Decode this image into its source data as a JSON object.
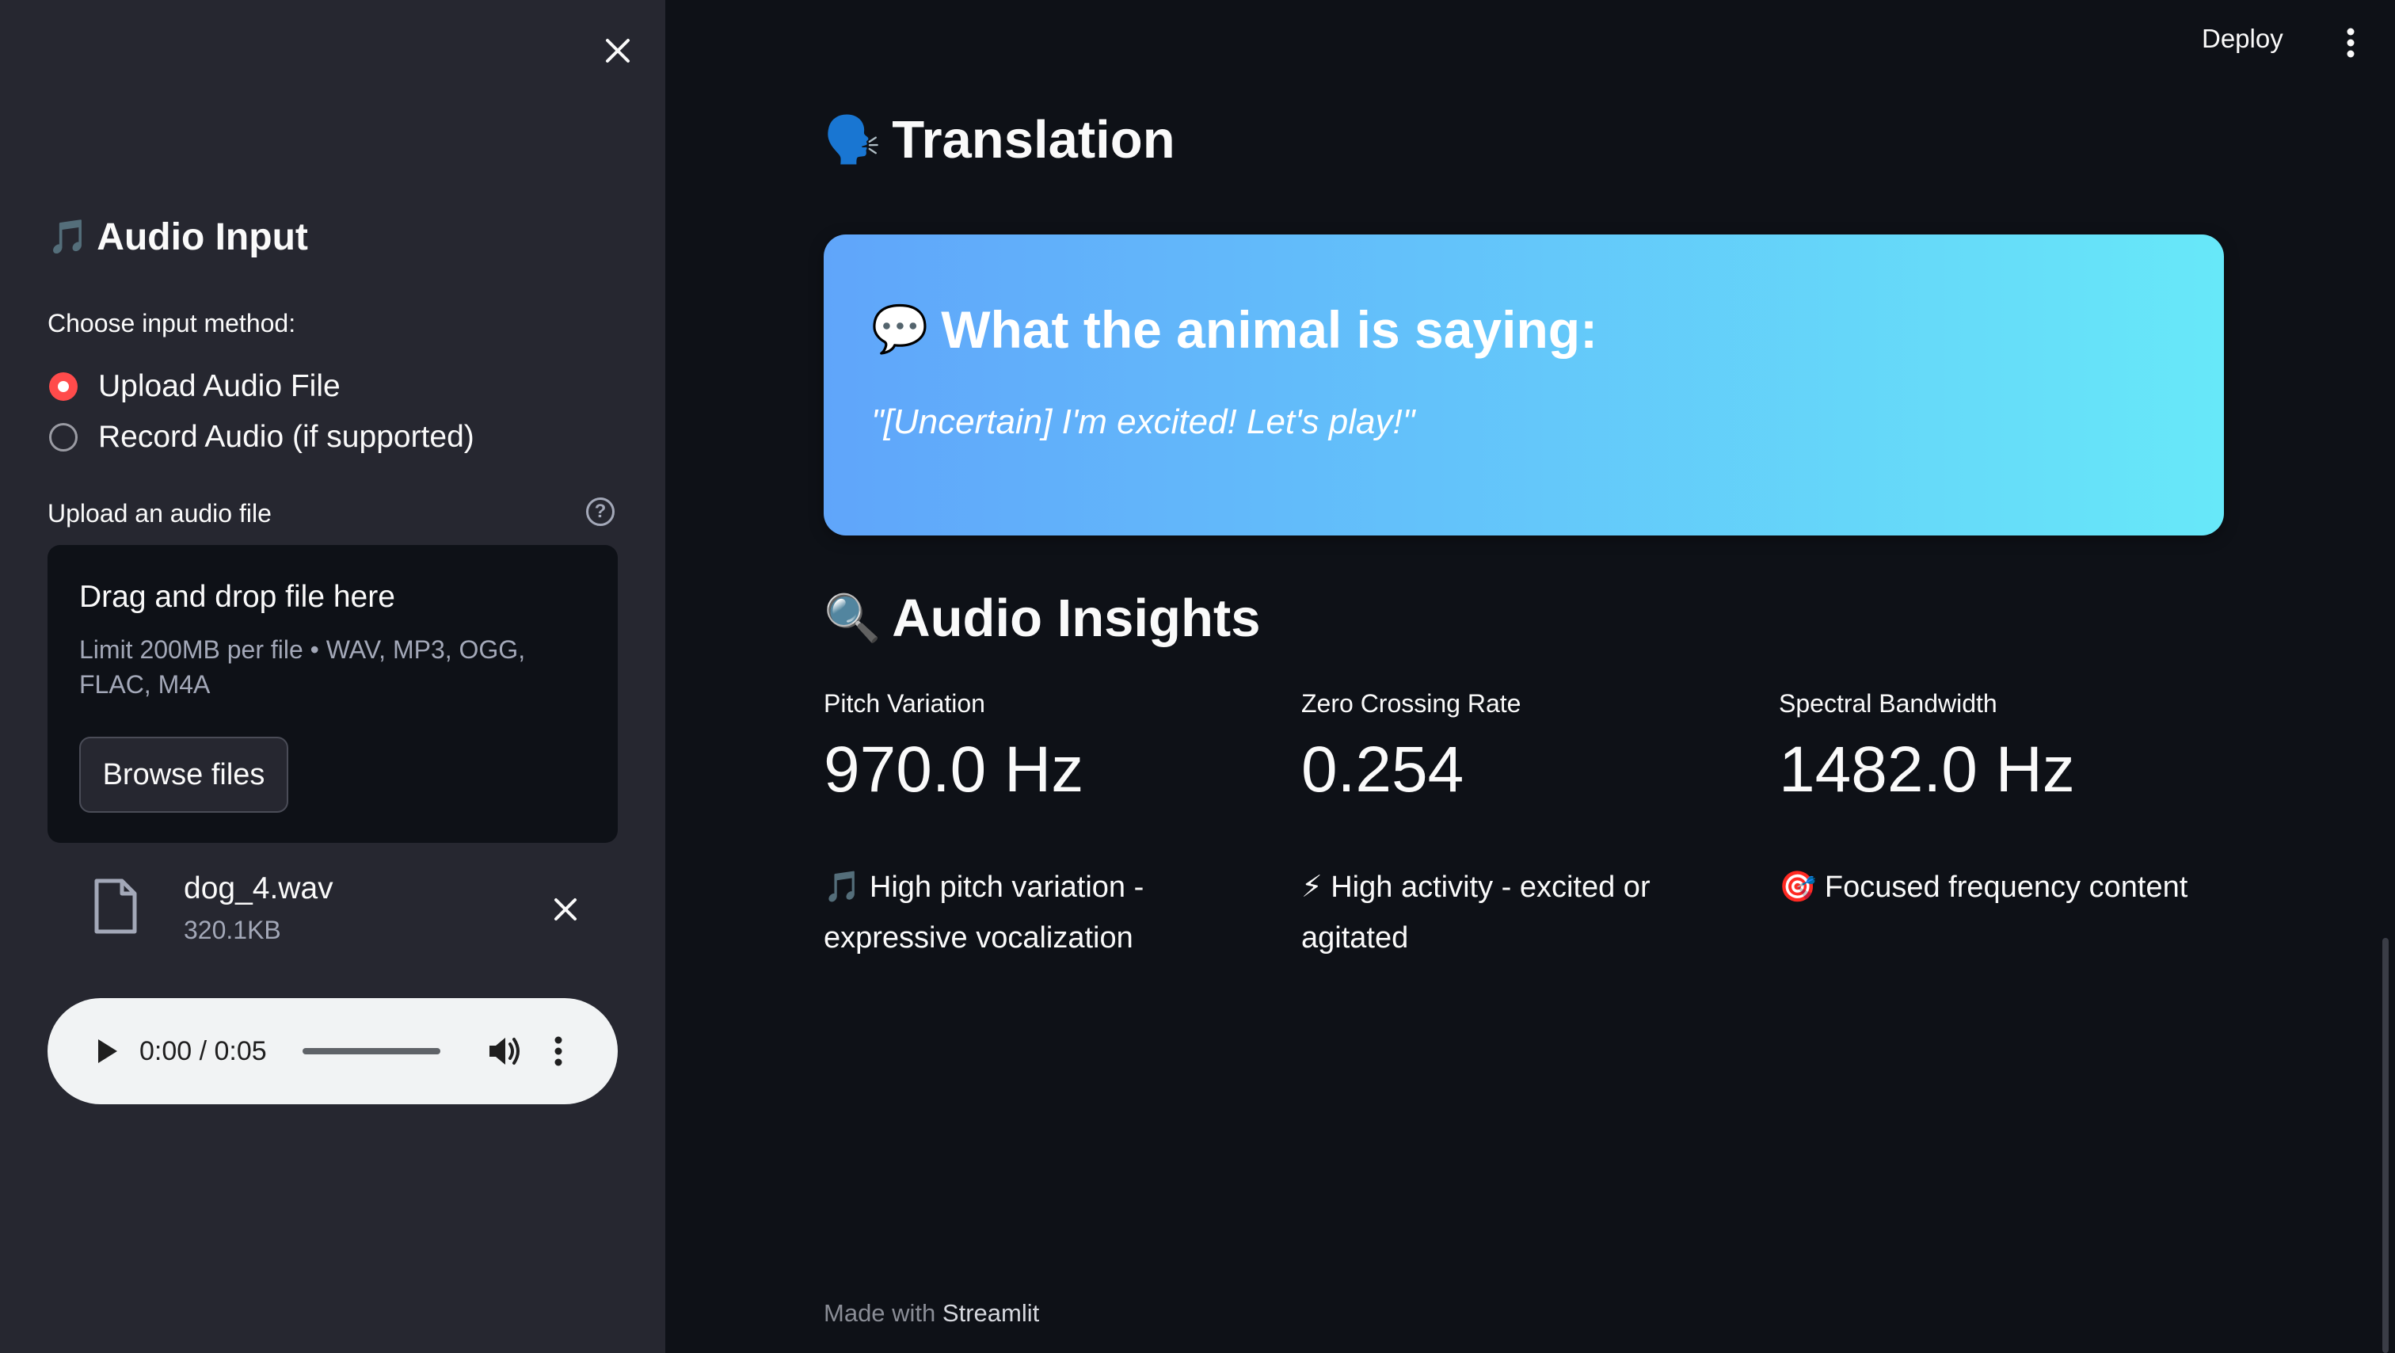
{
  "sidebar": {
    "header": {
      "emoji": "🎵",
      "title": "Audio Input"
    },
    "input_method": {
      "label": "Choose input method:",
      "options": [
        {
          "label": "Upload Audio File",
          "selected": true
        },
        {
          "label": "Record Audio (if supported)",
          "selected": false
        }
      ]
    },
    "uploader": {
      "label": "Upload an audio file",
      "help_icon": "question-circle-icon",
      "drop_title": "Drag and drop file here",
      "limit_text": "Limit 200MB per file • WAV, MP3, OGG, FLAC, M4A",
      "browse_label": "Browse files"
    },
    "file": {
      "name": "dog_4.wav",
      "size": "320.1KB",
      "icon": "file-icon"
    },
    "player": {
      "time": "0:00 / 0:05",
      "progress": 0
    }
  },
  "header": {
    "deploy_label": "Deploy",
    "menu_icon": "kebab-menu-icon"
  },
  "main": {
    "translation": {
      "emoji": "🗣️",
      "title": "Translation",
      "banner_emoji": "💬",
      "banner_title": "What the animal is saying:",
      "quote": "\"[Uncertain] I'm excited! Let's play!\"",
      "gradient": [
        "#60a5fa",
        "#67e8f9"
      ]
    },
    "insights": {
      "emoji": "🔍",
      "title": "Audio Insights",
      "metrics": [
        {
          "label": "Pitch Variation",
          "value": "970.0 Hz",
          "note": "🎵 High pitch variation - expressive vocalization"
        },
        {
          "label": "Zero Crossing Rate",
          "value": "0.254",
          "note": "⚡ High activity - excited or agitated"
        },
        {
          "label": "Spectral Bandwidth",
          "value": "1482.0 Hz",
          "note": "🎯 Focused frequency content"
        }
      ]
    }
  },
  "footer": {
    "prefix": "Made with",
    "brand": "Streamlit"
  },
  "colors": {
    "accent": "#ff4b4b",
    "background": "#0e1117",
    "sidebar": "#262730"
  }
}
